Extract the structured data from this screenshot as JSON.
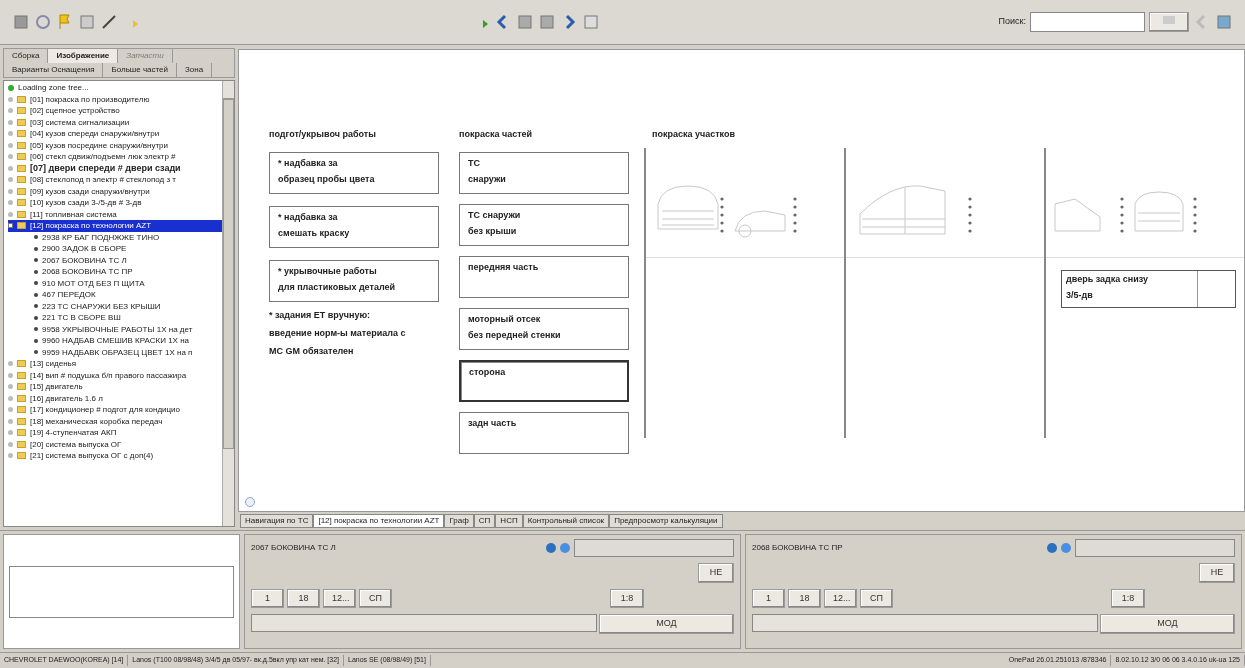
{
  "toolbar": {
    "search_label": "Поиск:"
  },
  "left_tabs": [
    [
      {
        "label": "Сборка",
        "selected": false,
        "disabled": false
      },
      {
        "label": "Изображение",
        "selected": true,
        "disabled": false
      },
      {
        "label": "Запчасти",
        "selected": false,
        "disabled": true
      }
    ],
    [
      {
        "label": "Варианты Оснащения",
        "selected": false,
        "disabled": false
      },
      {
        "label": "Больше частей",
        "selected": false,
        "disabled": false
      },
      {
        "label": "Зона",
        "selected": false,
        "disabled": false
      }
    ]
  ],
  "tree": {
    "status": "Loading zone tree...",
    "items": [
      {
        "label": "[01] покраска по производителю",
        "bold": false,
        "selected": false,
        "expanded": false
      },
      {
        "label": "[02] сцепное устройство",
        "bold": false,
        "selected": false,
        "expanded": false
      },
      {
        "label": "[03] система сигнализации",
        "bold": false,
        "selected": false,
        "expanded": false
      },
      {
        "label": "[04] кузов спереди снаружи/внутри",
        "bold": false,
        "selected": false,
        "expanded": false
      },
      {
        "label": "[05] кузов посредине снаружи/внутри",
        "bold": false,
        "selected": false,
        "expanded": false
      },
      {
        "label": "[06] стекл сдвиж/подъемн люк электр #",
        "bold": false,
        "selected": false,
        "expanded": false
      },
      {
        "label": "[07] двери спереди # двери сзади",
        "bold": true,
        "selected": false,
        "expanded": false
      },
      {
        "label": "[08] стеклопод п электр # стеклопод з т",
        "bold": false,
        "selected": false,
        "expanded": false
      },
      {
        "label": "[09] кузов сзади снаружи/внутри",
        "bold": false,
        "selected": false,
        "expanded": false
      },
      {
        "label": "[10] кузов сзади 3-/5-дв # 3-дв",
        "bold": false,
        "selected": false,
        "expanded": false
      },
      {
        "label": "[11] топливная система",
        "bold": false,
        "selected": false,
        "expanded": false
      },
      {
        "label": "[12] покраска по технологии AZT",
        "bold": false,
        "selected": true,
        "expanded": true,
        "children": [
          {
            "label": "2938 КР БАГ ПОДНЖЖЕ ТИНО"
          },
          {
            "label": "2900 ЗАДОК В СБОРЕ"
          },
          {
            "label": "2067 БОКОВИНА ТС Л"
          },
          {
            "label": "2068 БОКОВИНА ТС ПР"
          },
          {
            "label": "910 МОТ ОТД БЕЗ П ЩИТА"
          },
          {
            "label": "467 ПЕРЕДОК"
          },
          {
            "label": "223 ТС СНАРУЖИ БЕЗ КРЫШИ"
          },
          {
            "label": "221 ТС В СБОРЕ ВШ"
          },
          {
            "label": "9958 УКРЫВОЧНЫЕ РАБОТЫ 1Х на дет"
          },
          {
            "label": "9960 НАДБАВ СМЕШИВ КРАСКИ 1Х на"
          },
          {
            "label": "9959 НАДБАВК ОБРАЗЕЦ ЦВЕТ 1Х на п"
          }
        ]
      },
      {
        "label": "[13] сиденья",
        "bold": false,
        "selected": false,
        "expanded": false
      },
      {
        "label": "[14] вип # подушка б/п правого пассажира",
        "bold": false,
        "selected": false,
        "expanded": false
      },
      {
        "label": "[15] двигатель",
        "bold": false,
        "selected": false,
        "expanded": false
      },
      {
        "label": "[16] двигатель 1.6 л",
        "bold": false,
        "selected": false,
        "expanded": false
      },
      {
        "label": "[17] кондиционер # подгот для кондицио",
        "bold": false,
        "selected": false,
        "expanded": false
      },
      {
        "label": "[18] механическая коробка передач",
        "bold": false,
        "selected": false,
        "expanded": false
      },
      {
        "label": "[19] 4-ступенчатая АКП",
        "bold": false,
        "selected": false,
        "expanded": false
      },
      {
        "label": "[20] система выпуска ОГ",
        "bold": false,
        "selected": false,
        "expanded": false
      },
      {
        "label": "[21] система выпуска ОГ с доп(4)",
        "bold": false,
        "selected": false,
        "expanded": false
      }
    ]
  },
  "canvas": {
    "prep": {
      "heading": "подгот/укрывоч работы",
      "boxes": [
        {
          "lines": [
            "* надбавка за",
            "образец пробы цвета"
          ],
          "selected": false
        },
        {
          "lines": [
            "* надбавка за",
            "смешать краску"
          ],
          "selected": false
        },
        {
          "lines": [
            "* укрывочные работы",
            "для пластиковых деталей"
          ],
          "selected": false
        }
      ],
      "note": [
        "* задания ET вручную:",
        "введение норм-ы материала с",
        "MC  GM  обязателен"
      ]
    },
    "parts": {
      "heading": "покраска частей",
      "boxes": [
        {
          "lines": [
            "ТС",
            "снаружи"
          ],
          "selected": false
        },
        {
          "lines": [
            "ТС снаружи",
            "без крыши"
          ],
          "selected": false
        },
        {
          "lines": [
            "передняя часть"
          ],
          "selected": false
        },
        {
          "lines": [
            "моторный отсек",
            "без передней стенки"
          ],
          "selected": false
        },
        {
          "lines": [
            "сторона"
          ],
          "selected": true
        },
        {
          "lines": [
            "задн часть"
          ],
          "selected": false
        }
      ]
    },
    "areas": {
      "heading": "покраска участков",
      "box": {
        "lines": [
          "дверь задка снизу",
          "3/5-дв"
        ]
      }
    }
  },
  "bottom_tabs": [
    {
      "label": "Навигация по ТС",
      "selected": false
    },
    {
      "label": "[12] покраска по технологии AZT",
      "selected": true
    },
    {
      "label": "Граф",
      "selected": false
    },
    {
      "label": "СП",
      "selected": false
    },
    {
      "label": "НСП",
      "selected": false
    },
    {
      "label": "Контрольный список",
      "selected": false
    },
    {
      "label": "Предпросмотр калькуляции",
      "selected": false
    }
  ],
  "part_panels": [
    {
      "title": "2067 БОКОВИНА ТС Л",
      "side_button": "НЕ",
      "buttons": [
        "1",
        "18",
        "12...",
        "СП"
      ],
      "ratio_button": "1:8",
      "mode_button": "МОД"
    },
    {
      "title": "2068 БОКОВИНА ТС ПР",
      "side_button": "НЕ",
      "buttons": [
        "1",
        "18",
        "12...",
        "СП"
      ],
      "ratio_button": "1:8",
      "mode_button": "МОД"
    }
  ],
  "status_bar": [
    "CHEVROLET DAEWOO(KOREA) [14]",
    "Lanos (T100 08/98/48) 3/4/5 дв 05/97- вк.д.5вкл упр кат нем. [32]",
    "Lanos SE (08/98/49) [51]",
    "OnePad 26.01.251013 /878346",
    "8.02.10.12 3/0 06 06 3.4.0.16 uk-ua 125"
  ]
}
